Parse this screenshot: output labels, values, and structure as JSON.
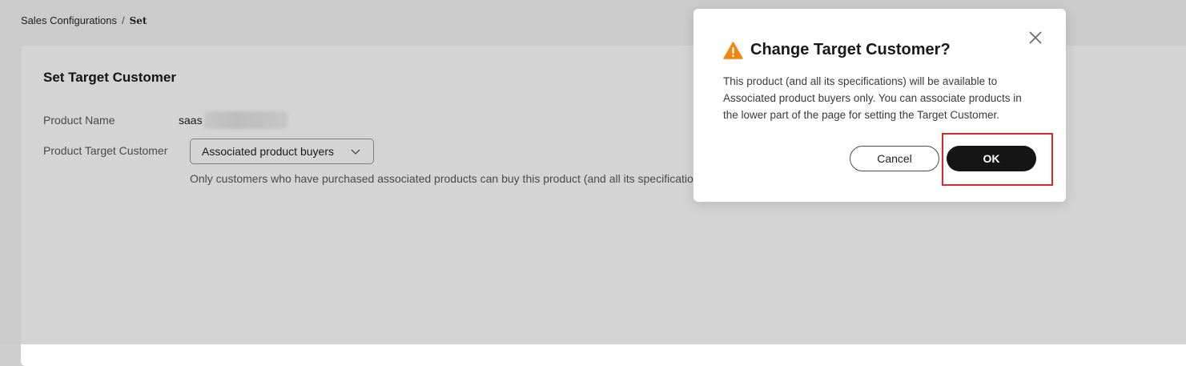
{
  "breadcrumb": {
    "parent": "Sales Configurations",
    "separator": "/",
    "current": "Set"
  },
  "card": {
    "title": "Set Target Customer",
    "product_name_label": "Product Name",
    "product_name_value": "saas",
    "target_customer_label": "Product Target Customer",
    "target_customer_value": "Associated product buyers",
    "hint": "Only customers who have purchased associated products can buy this product (and all its specifications"
  },
  "modal": {
    "title": "Change Target Customer?",
    "body": "This product (and all its specifications) will be available to Associated product buyers only. You can associate products in the lower part of the page for setting the Target Customer.",
    "cancel_label": "Cancel",
    "ok_label": "OK",
    "icons": {
      "warning": "warning-icon",
      "close": "close-icon"
    }
  },
  "colors": {
    "warning": "#f5840c",
    "primary_button": "#151515",
    "highlight": "#e0252b"
  }
}
